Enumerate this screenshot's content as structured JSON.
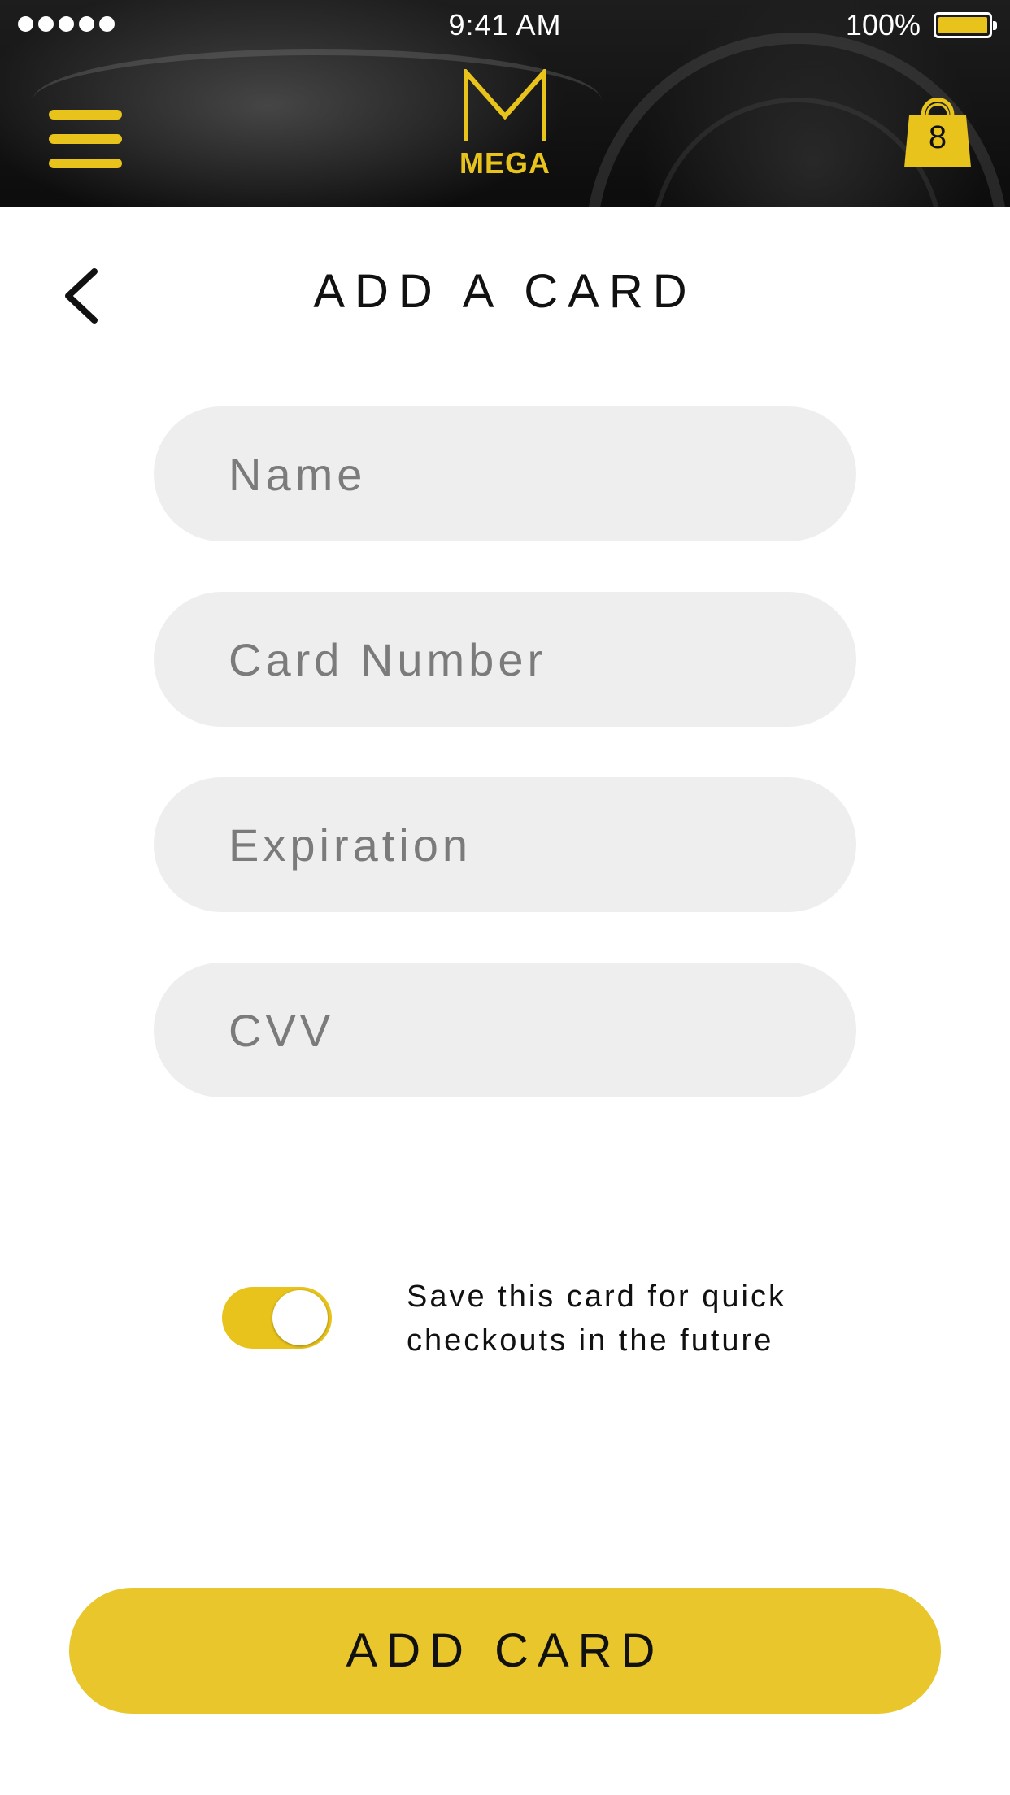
{
  "status_bar": {
    "time": "9:41 AM",
    "battery_percent": "100%",
    "signal_bars": 5
  },
  "header": {
    "menu_icon": "hamburger-menu-icon",
    "logo_text": "MEGA",
    "cart_icon": "shopping-bag-icon",
    "cart_count": "8"
  },
  "page": {
    "back_icon": "chevron-left-icon",
    "title": "ADD A CARD"
  },
  "form": {
    "name_placeholder": "Name",
    "card_number_placeholder": "Card Number",
    "expiration_placeholder": "Expiration",
    "cvv_placeholder": "CVV"
  },
  "save_card": {
    "enabled": true,
    "label_line1": "Save this card for quick",
    "label_line2": "checkouts in the future"
  },
  "submit": {
    "label": "ADD CARD"
  },
  "colors": {
    "accent": "#e8c31b",
    "field_bg": "#eeeeee",
    "text": "#111111"
  }
}
